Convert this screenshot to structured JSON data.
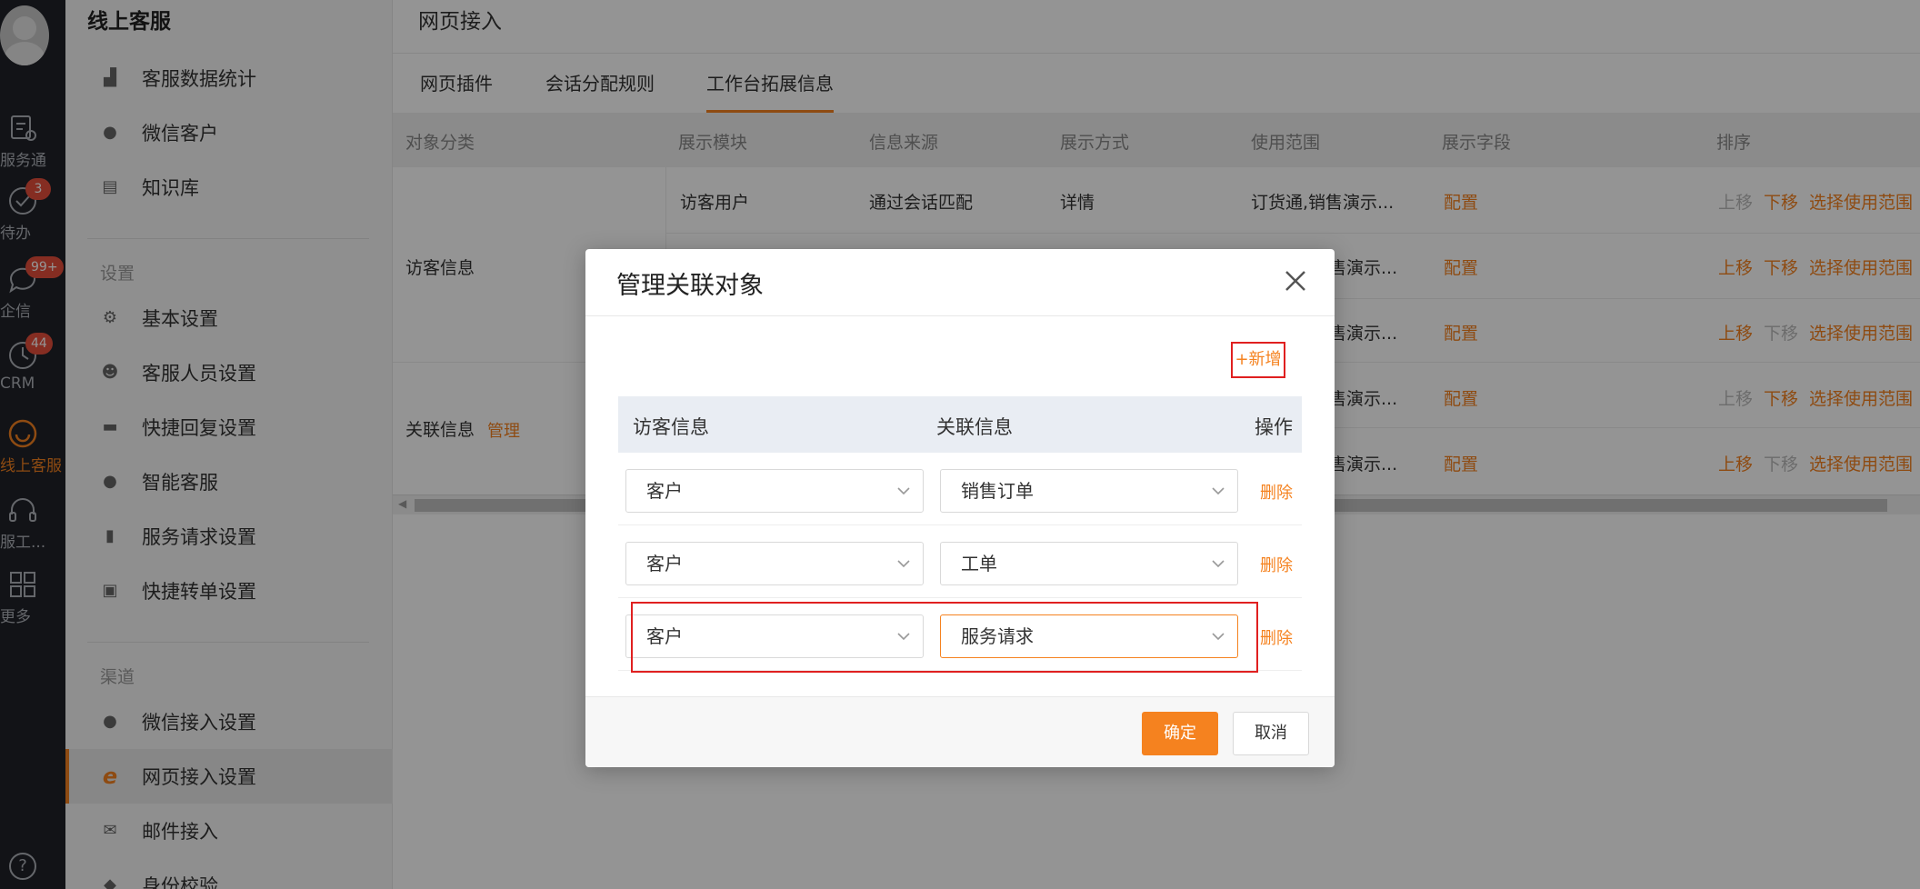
{
  "rail": {
    "items": [
      {
        "label": "服务通",
        "icon": "service-icon"
      },
      {
        "label": "待办",
        "icon": "check-circle-icon",
        "badge": "3"
      },
      {
        "label": "企信",
        "icon": "chat-bubble-icon",
        "badge": "99+"
      },
      {
        "label": "CRM",
        "icon": "clock-icon",
        "badge": "44"
      },
      {
        "label": "线上客服",
        "icon": "smile-icon"
      },
      {
        "label": "服工...",
        "icon": "headset-icon"
      },
      {
        "label": "更多",
        "icon": "grid-icon"
      }
    ],
    "help": "?"
  },
  "sidebar": {
    "title": "线上客服",
    "items": [
      {
        "label": "客服数据统计"
      },
      {
        "label": "微信客户"
      },
      {
        "label": "知识库"
      }
    ],
    "section_settings": "设置",
    "settings_items": [
      {
        "label": "基本设置"
      },
      {
        "label": "客服人员设置"
      },
      {
        "label": "快捷回复设置"
      },
      {
        "label": "智能客服"
      },
      {
        "label": "服务请求设置"
      },
      {
        "label": "快捷转单设置"
      }
    ],
    "section_channels": "渠道",
    "channel_items": [
      {
        "label": "微信接入设置"
      },
      {
        "label": "网页接入设置"
      },
      {
        "label": "邮件接入"
      },
      {
        "label": "身份校验"
      }
    ]
  },
  "main": {
    "title": "网页接入",
    "tabs": [
      {
        "label": "网页插件"
      },
      {
        "label": "会话分配规则"
      },
      {
        "label": "工作台拓展信息"
      }
    ],
    "table": {
      "headers": [
        "对象分类",
        "展示模块",
        "信息来源",
        "展示方式",
        "使用范围",
        "展示字段",
        "排序"
      ],
      "category1": "访客信息",
      "category2": "关联信息",
      "category2_action": "管理",
      "first_row": {
        "module": "访客用户",
        "source": "通过会话匹配",
        "display": "详情",
        "scope": "订货通,销售演示..."
      },
      "scope_suffix": "售演示...",
      "config": "配置",
      "up": "上移",
      "down": "下移",
      "select_scope": "选择使用范围"
    }
  },
  "modal": {
    "title": "管理关联对象",
    "add_label": "+新增",
    "col_visitor": "访客信息",
    "col_related": "关联信息",
    "col_action": "操作",
    "rows": [
      {
        "visitor": "客户",
        "related": "销售订单",
        "delete": "删除"
      },
      {
        "visitor": "客户",
        "related": "工单",
        "delete": "删除"
      },
      {
        "visitor": "客户",
        "related": "服务请求",
        "delete": "删除"
      }
    ],
    "ok_label": "确定",
    "cancel_label": "取消"
  },
  "colors": {
    "accent": "#f5821f",
    "rail_bg": "#1f2229",
    "badge": "#e64e3c",
    "highlight_box": "#e02020"
  }
}
